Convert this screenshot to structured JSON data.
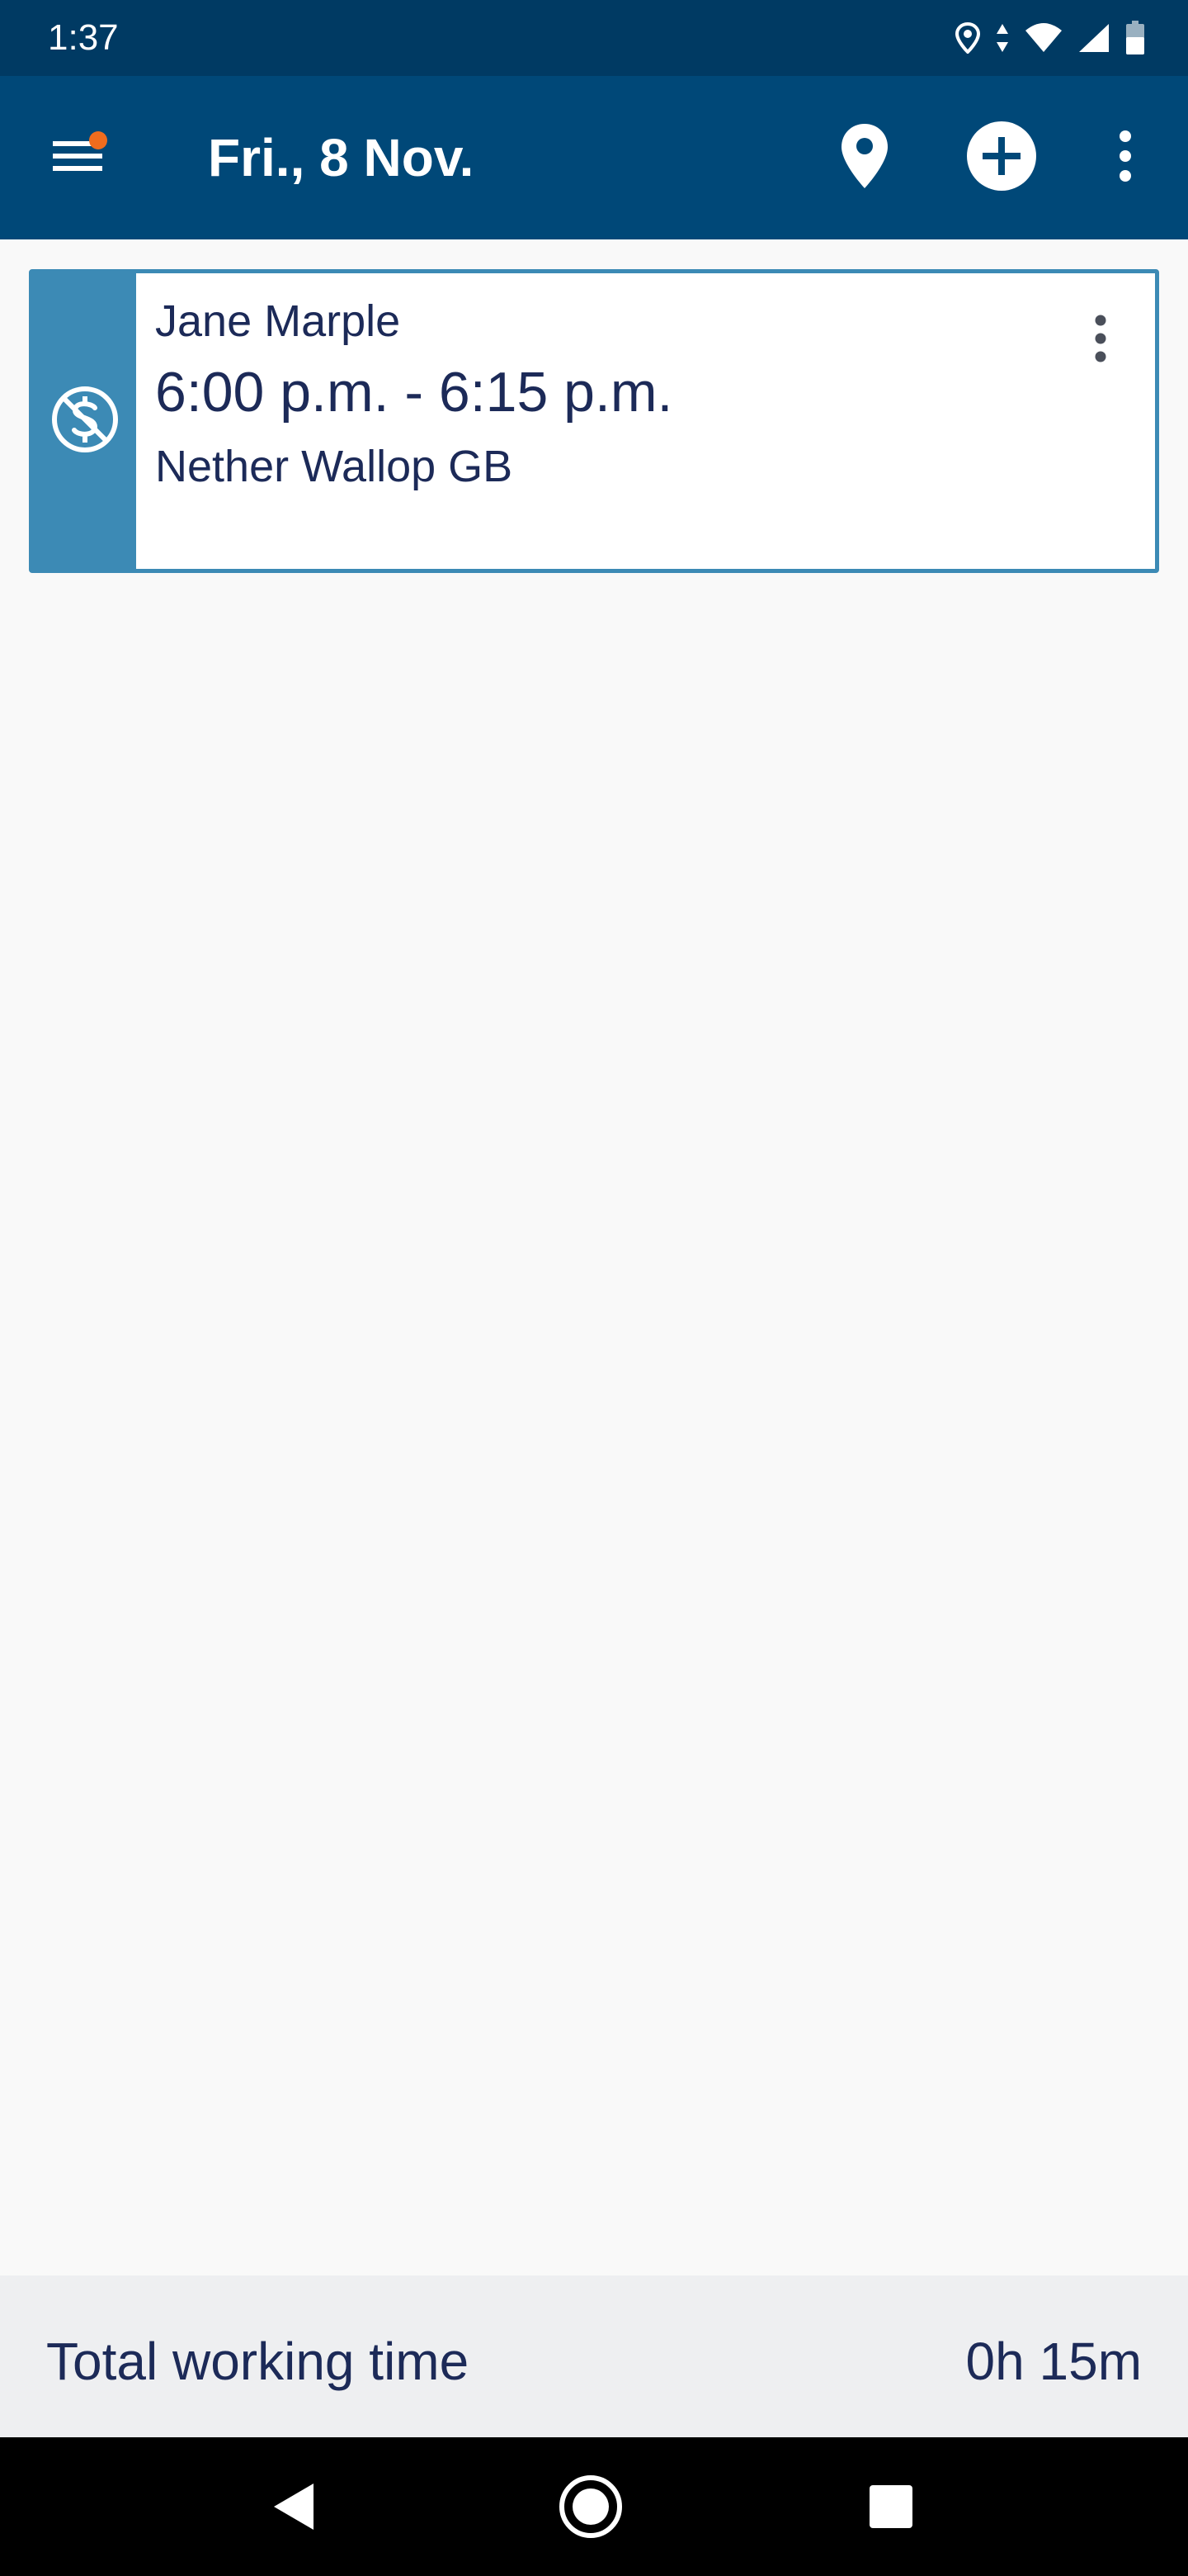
{
  "status_bar": {
    "time": "1:37",
    "icons": [
      "location-icon",
      "data-arrows-icon",
      "wifi-icon",
      "signal-icon",
      "battery-icon"
    ]
  },
  "app_bar": {
    "title": "Fri., 8 Nov.",
    "menu_icon": "hamburger-menu-icon",
    "has_notification_badge": true,
    "actions": [
      "map-pin-icon",
      "add-circle-icon",
      "more-vertical-icon"
    ]
  },
  "appointments": [
    {
      "name": "Jane Marple",
      "time": "6:00 p.m. - 6:15 p.m.",
      "location": "Nether Wallop GB",
      "icon": "no-money-icon"
    }
  ],
  "footer": {
    "total_label": "Total working time",
    "total_value": "0h 15m"
  },
  "nav_bar": {
    "buttons": [
      "back-icon",
      "home-icon",
      "recents-icon"
    ]
  },
  "colors": {
    "status_bar": "#003a63",
    "app_bar": "#004878",
    "card_accent": "#3c8ab5",
    "text_primary": "#1c2a58",
    "badge": "#ef6c1e",
    "footer_bg": "#eeeff1",
    "page_bg": "#f9f9f9"
  }
}
